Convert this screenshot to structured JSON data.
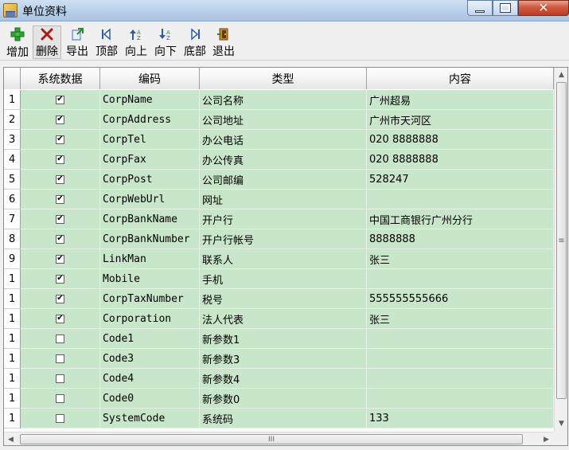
{
  "window": {
    "title": "单位资料",
    "minimize_icon": "minimize-icon",
    "maximize_icon": "maximize-icon",
    "close_icon": "close-icon"
  },
  "toolbar": {
    "add": {
      "label": "增加",
      "icon": "add-icon"
    },
    "delete": {
      "label": "删除",
      "icon": "delete-icon"
    },
    "export": {
      "label": "导出",
      "icon": "export-icon"
    },
    "top": {
      "label": "顶部",
      "icon": "first-record-icon"
    },
    "up": {
      "label": "向上",
      "icon": "sort-up-icon"
    },
    "down": {
      "label": "向下",
      "icon": "sort-down-icon"
    },
    "bottom": {
      "label": "底部",
      "icon": "last-record-icon"
    },
    "exit": {
      "label": "退出",
      "icon": "exit-icon"
    }
  },
  "grid": {
    "columns": [
      "系统数据",
      "编码",
      "类型",
      "内容"
    ],
    "rows": [
      {
        "num": "1",
        "system": true,
        "code": "CorpName",
        "type": "公司名称",
        "content": "广州超易"
      },
      {
        "num": "2",
        "system": true,
        "code": "CorpAddress",
        "type": "公司地址",
        "content": "广州市天河区"
      },
      {
        "num": "3",
        "system": true,
        "code": "CorpTel",
        "type": "办公电话",
        "content": "020 8888888"
      },
      {
        "num": "4",
        "system": true,
        "code": "CorpFax",
        "type": "办公传真",
        "content": "020 8888888"
      },
      {
        "num": "5",
        "system": true,
        "code": "CorpPost",
        "type": "公司邮编",
        "content": "528247"
      },
      {
        "num": "6",
        "system": true,
        "code": "CorpWebUrl",
        "type": "网址",
        "content": ""
      },
      {
        "num": "7",
        "system": true,
        "code": "CorpBankName",
        "type": "开户行",
        "content": "中国工商银行广州分行"
      },
      {
        "num": "8",
        "system": true,
        "code": "CorpBankNumber",
        "type": "开户行帐号",
        "content": "8888888"
      },
      {
        "num": "9",
        "system": true,
        "code": "LinkMan",
        "type": "联系人",
        "content": "张三"
      },
      {
        "num": "1",
        "system": true,
        "code": "Mobile",
        "type": "手机",
        "content": ""
      },
      {
        "num": "1",
        "system": true,
        "code": "CorpTaxNumber",
        "type": "税号",
        "content": "555555555666"
      },
      {
        "num": "1",
        "system": true,
        "code": "Corporation",
        "type": "法人代表",
        "content": "张三"
      },
      {
        "num": "1",
        "system": false,
        "code": "Code1",
        "type": "新参数1",
        "content": ""
      },
      {
        "num": "1",
        "system": false,
        "code": "Code3",
        "type": "新参数3",
        "content": ""
      },
      {
        "num": "1",
        "system": false,
        "code": "Code4",
        "type": "新参数4",
        "content": ""
      },
      {
        "num": "1",
        "system": false,
        "code": "Code0",
        "type": "新参数0",
        "content": ""
      },
      {
        "num": "1",
        "system": false,
        "code": "SystemCode",
        "type": "系统码",
        "content": "133"
      }
    ]
  },
  "scrollbars": {
    "vertical_grip": "≡",
    "horizontal_grip": "III"
  },
  "colors": {
    "row_background": "#c8e6c9",
    "title_bar": "#b9d1ea",
    "close_button": "#c13f22"
  }
}
